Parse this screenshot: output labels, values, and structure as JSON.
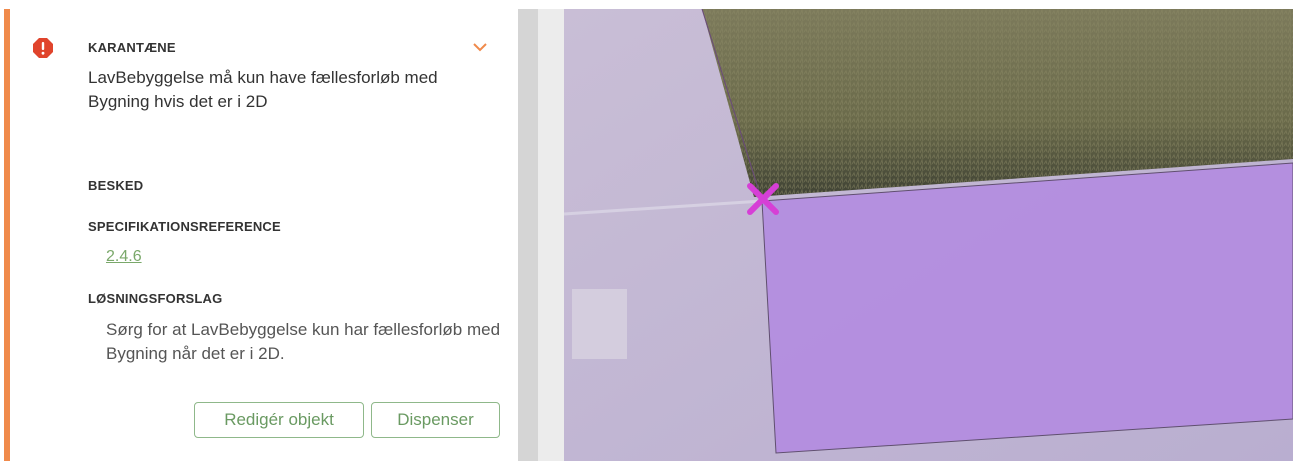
{
  "card": {
    "severity_title": "KARANTÆNE",
    "message": "LavBebyggelse må kun have fællesforløb med Bygning hvis det er i 2D",
    "besked_label": "BESKED",
    "spec_label": "SPECIFIKATIONSREFERENCE",
    "spec_link": "2.4.6",
    "solution_label": "LØSNINGSFORSLAG",
    "solution_text": "Sørg for at LavBebyggelse kun har fællesforløb med Bygning når det er i 2D.",
    "edit_button": "Redigér objekt",
    "dispense_button": "Dispenser"
  },
  "colors": {
    "accent": "#f08a4b",
    "error_icon": "#e0442c",
    "button_green": "#6a9a62",
    "marker": "#d63fd6",
    "polygon": "#b48ee0"
  },
  "icons": {
    "severity": "error-octagon-icon",
    "toggle": "chevron-down-icon",
    "marker": "x-marker-icon"
  }
}
